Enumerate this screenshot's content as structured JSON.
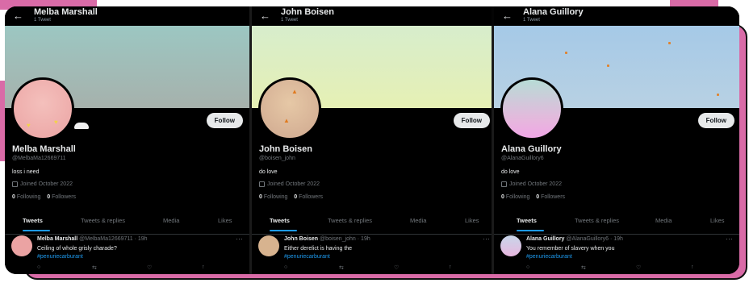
{
  "profiles": [
    {
      "header_name": "Melba Marshall",
      "tweet_count": "1 Tweet",
      "name": "Melba Marshall",
      "handle": "@MelbaMa12669711",
      "bio": "loss i need",
      "joined": "Joined October 2022",
      "following_count": "0",
      "following_label": "Following",
      "followers_count": "0",
      "followers_label": "Followers",
      "follow_label": "Follow",
      "tabs": [
        "Tweets",
        "Tweets & replies",
        "Media",
        "Likes"
      ],
      "tweet": {
        "author": "Melba Marshall",
        "meta": "@MelbaMa12669711 · 19h",
        "text": "Ceiling of whole grisly charade?",
        "hashtag": "#penuriecarburant"
      }
    },
    {
      "header_name": "John Boisen",
      "tweet_count": "1 Tweet",
      "name": "John Boisen",
      "handle": "@boisen_john",
      "bio": "do love",
      "joined": "Joined October 2022",
      "following_count": "0",
      "following_label": "Following",
      "followers_count": "0",
      "followers_label": "Followers",
      "follow_label": "Follow",
      "tabs": [
        "Tweets",
        "Tweets & replies",
        "Media",
        "Likes"
      ],
      "tweet": {
        "author": "John Boisen",
        "meta": "@boisen_john · 19h",
        "text": "Either derelict is having the",
        "hashtag": "#penuriecarburant"
      }
    },
    {
      "header_name": "Alana Guillory",
      "tweet_count": "1 Tweet",
      "name": "Alana Guillory",
      "handle": "@AlanaGuillory6",
      "bio": "do love",
      "joined": "Joined October 2022",
      "following_count": "0",
      "following_label": "Following",
      "followers_count": "0",
      "followers_label": "Followers",
      "follow_label": "Follow",
      "tabs": [
        "Tweets",
        "Tweets & replies",
        "Media",
        "Likes"
      ],
      "tweet": {
        "author": "Alana Guillory",
        "meta": "@AlanaGuillory6 · 19h",
        "text": "You remember of slavery when you",
        "hashtag": "#penuriecarburant"
      }
    }
  ],
  "icons": {
    "back": "arrow-left-icon",
    "calendar": "calendar-icon",
    "more": "more-icon",
    "reply": "reply-icon",
    "retweet": "retweet-icon",
    "like": "like-icon",
    "share": "share-icon"
  },
  "colors": {
    "accent": "#1d9bf0",
    "background_pink": "#d96ba7"
  }
}
